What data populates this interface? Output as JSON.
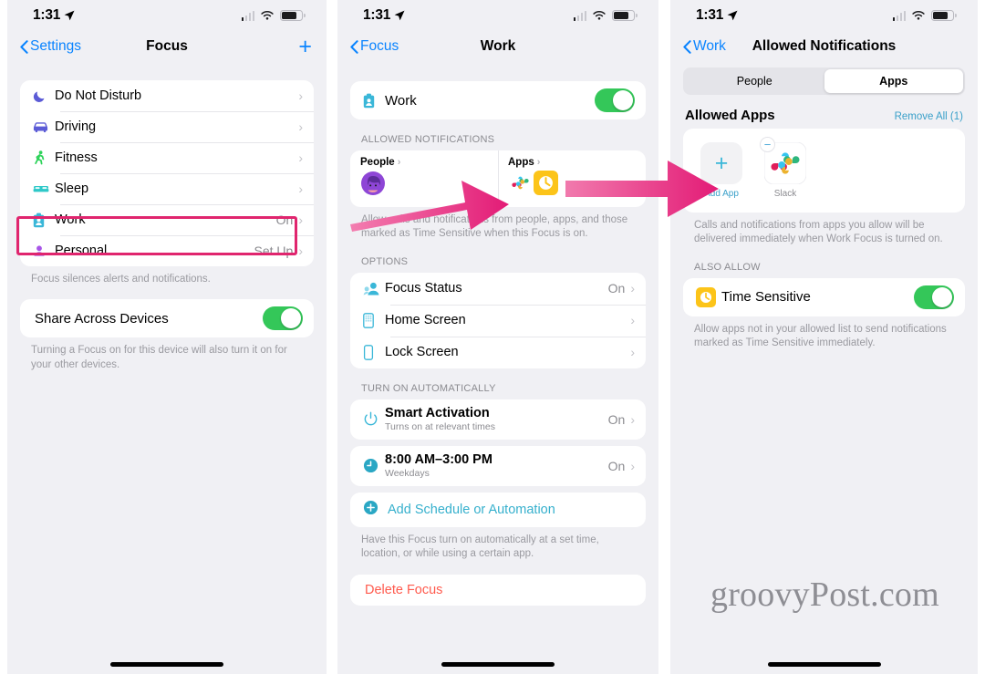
{
  "colors": {
    "accent_blue": "#0a84ff",
    "teal": "#3ab7d8",
    "green_toggle": "#34c759",
    "highlight_pink": "#e0256e",
    "arrow_pink": "#e32a7c",
    "danger_red": "#ff5a4d",
    "screen_bg": "#f0f0f4",
    "card_white": "#ffffff"
  },
  "status_bar": {
    "time": "1:31",
    "location_icon": "location-arrow-icon",
    "wifi_icon": "wifi-icon",
    "battery_icon": "battery-icon",
    "cellular_icon": "cellular-bars-icon"
  },
  "watermark": "groovyPost.com",
  "panel1": {
    "nav": {
      "back_label": "Settings",
      "title": "Focus",
      "add_icon": "plus-icon"
    },
    "focus_list": [
      {
        "icon": "moon-icon",
        "label": "Do Not Disturb",
        "value": "",
        "chevron": "›"
      },
      {
        "icon": "car-icon",
        "label": "Driving",
        "value": "",
        "chevron": "›"
      },
      {
        "icon": "running-icon",
        "label": "Fitness",
        "value": "",
        "chevron": "›"
      },
      {
        "icon": "bed-icon",
        "label": "Sleep",
        "value": "",
        "chevron": "›"
      },
      {
        "icon": "badge-icon",
        "label": "Work",
        "value": "On",
        "chevron": "›"
      },
      {
        "icon": "person-icon",
        "label": "Personal",
        "value": "Set Up",
        "chevron": "›"
      }
    ],
    "focus_footnote": "Focus silences alerts and notifications.",
    "share": {
      "label": "Share Across Devices",
      "toggle_state": "on"
    },
    "share_footnote": "Turning a Focus on for this device will also turn it on for your other devices."
  },
  "panel2": {
    "nav": {
      "back_label": "Focus",
      "title": "Work"
    },
    "work_row": {
      "icon": "badge-icon",
      "label": "Work",
      "toggle_state": "on"
    },
    "allowed_header": "ALLOWED NOTIFICATIONS",
    "people_card": {
      "title": "People",
      "chevron": "›",
      "icon": "avatar-icon"
    },
    "apps_card": {
      "title": "Apps",
      "chevron": "›",
      "icons": [
        "slack-icon",
        "time-sensitive-icon"
      ]
    },
    "allowed_footnote": "Allow calls and notifications from people, apps, and those marked as Time Sensitive when this Focus is on.",
    "options_header": "OPTIONS",
    "options": [
      {
        "icon": "focus-status-icon",
        "label": "Focus Status",
        "value": "On",
        "chevron": "›"
      },
      {
        "icon": "home-screen-icon",
        "label": "Home Screen",
        "value": "",
        "chevron": "›"
      },
      {
        "icon": "lock-screen-icon",
        "label": "Lock Screen",
        "value": "",
        "chevron": "›"
      }
    ],
    "auto_header": "TURN ON AUTOMATICALLY",
    "automations": [
      {
        "icon": "power-icon",
        "label": "Smart Activation",
        "sublabel": "Turns on at relevant times",
        "value": "On",
        "chevron": "›"
      },
      {
        "icon": "clock-icon",
        "label": "8:00 AM–3:00 PM",
        "sublabel": "Weekdays",
        "value": "On",
        "chevron": "›"
      }
    ],
    "add_schedule": {
      "icon": "plus-circle-icon",
      "label": "Add Schedule or Automation"
    },
    "auto_footnote": "Have this Focus turn on automatically at a set time, location, or while using a certain app.",
    "delete": {
      "label": "Delete Focus"
    }
  },
  "panel3": {
    "nav": {
      "back_label": "Work",
      "title": "Allowed Notifications"
    },
    "segmented": {
      "options": [
        "People",
        "Apps"
      ],
      "selected": "Apps"
    },
    "allowed_apps": {
      "title": "Allowed Apps",
      "remove_all": "Remove All (1)"
    },
    "app_tiles": [
      {
        "icon": "plus-icon",
        "name": "Add App",
        "type": "add"
      },
      {
        "icon": "slack-icon",
        "name": "Slack",
        "type": "app",
        "badge": "minus-badge-icon"
      }
    ],
    "apps_footnote": "Calls and notifications from apps you allow will be delivered immediately when Work Focus is turned on.",
    "also_allow_header": "ALSO ALLOW",
    "time_sensitive": {
      "icon": "time-sensitive-icon",
      "label": "Time Sensitive",
      "toggle_state": "on"
    },
    "time_sensitive_footnote": "Allow apps not in your allowed list to send notifications marked as Time Sensitive immediately."
  }
}
